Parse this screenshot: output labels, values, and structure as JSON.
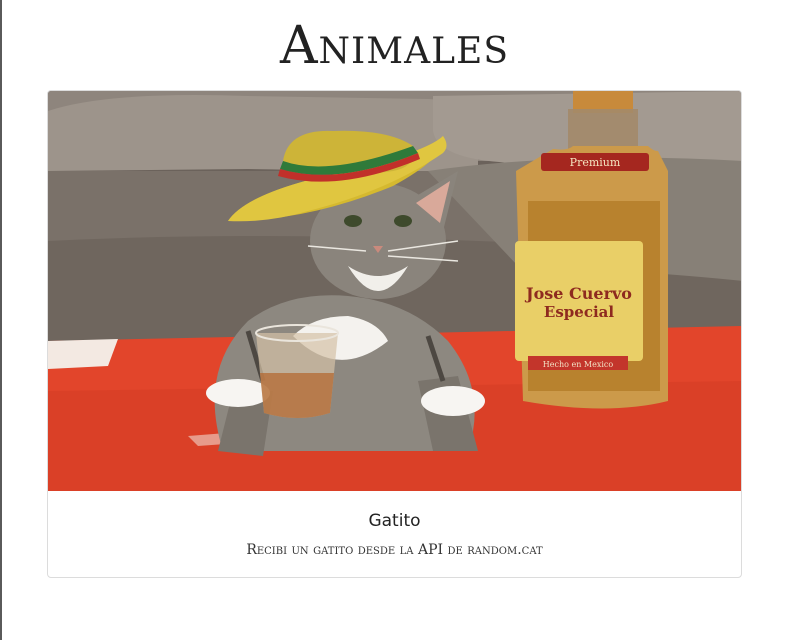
{
  "header": {
    "title": "Animales"
  },
  "card": {
    "title": "Gatito",
    "text": "Recibi un gatito desde la API de random.cat",
    "image": {
      "subject": "cat wearing sombrero beside tequila bottle and shot glass",
      "bottle_label_top": "Premium",
      "bottle_label_brand": "Jose Cuervo",
      "bottle_label_sub": "Especial",
      "bottle_label_bottom": "Hecho en Mexico"
    }
  }
}
